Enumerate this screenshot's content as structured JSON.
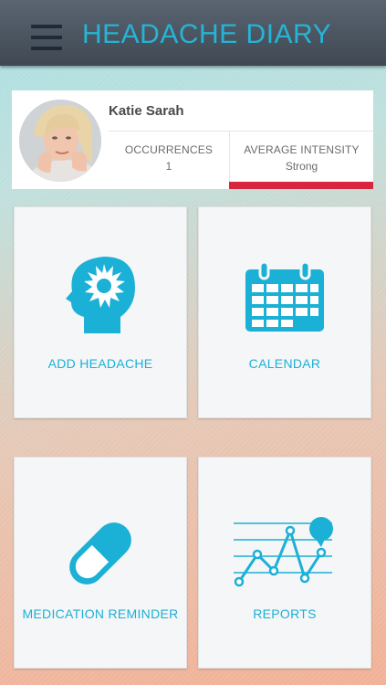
{
  "header": {
    "title": "HEADACHE DIARY",
    "menu_icon": "hamburger-menu-icon"
  },
  "profile": {
    "name": "Katie Sarah",
    "avatar": "user-avatar-photo",
    "stats": {
      "occurrences_label": "OCCURRENCES",
      "occurrences_value": "1",
      "intensity_label": "AVERAGE INTENSITY",
      "intensity_value": "Strong",
      "intensity_color": "#d7263d"
    }
  },
  "tiles": [
    {
      "label": "ADD HEADACHE",
      "icon": "head-pain-icon"
    },
    {
      "label": "CALENDAR",
      "icon": "calendar-icon"
    },
    {
      "label": "MEDICATION REMINDER",
      "icon": "pill-icon"
    },
    {
      "label": "REPORTS",
      "icon": "line-chart-icon"
    }
  ],
  "colors": {
    "accent": "#1bb0d6",
    "header_bg": "#46505b"
  }
}
